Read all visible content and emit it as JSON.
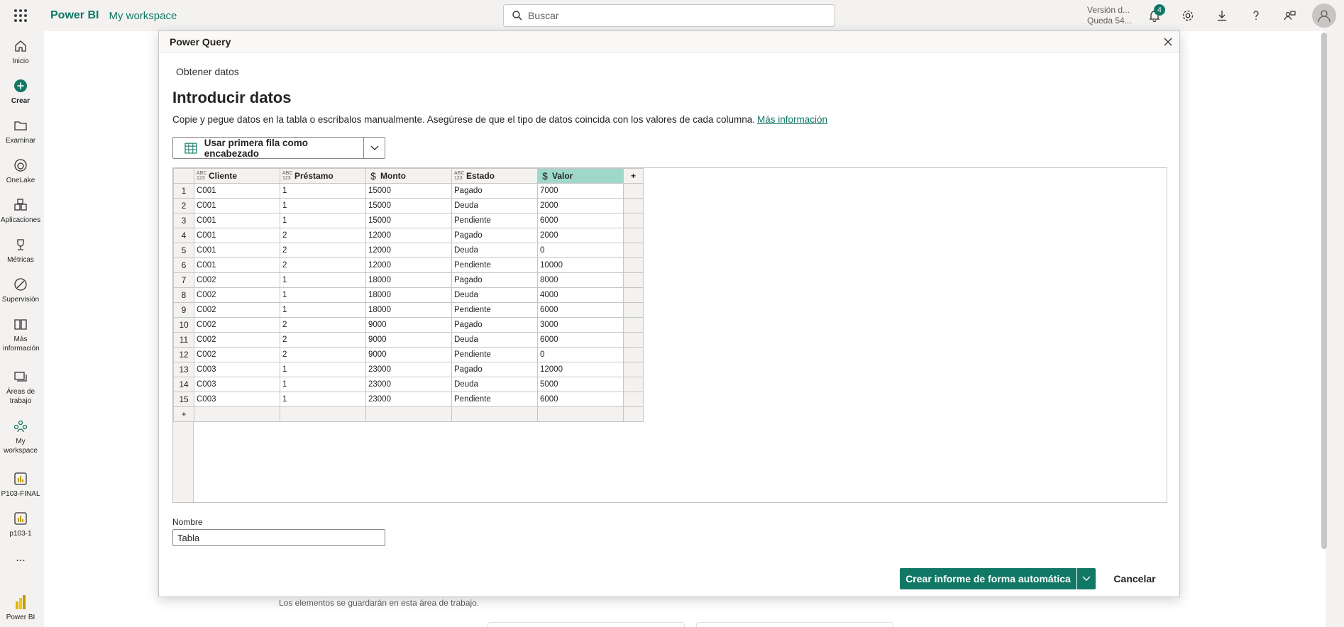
{
  "topbar": {
    "brand": "Power BI",
    "workspace": "My workspace",
    "search_placeholder": "Buscar",
    "trial_line1": "Versión d...",
    "trial_line2": "Queda 54...",
    "notification_count": "4",
    "icons": [
      "app-launcher-icon",
      "bell-icon",
      "gear-icon",
      "download-icon",
      "help-icon",
      "share-icon",
      "user-avatar-icon"
    ]
  },
  "leftnav": {
    "items": [
      {
        "label": "Inicio",
        "icon": "home-icon"
      },
      {
        "label": "Crear",
        "icon": "create-plus-icon"
      },
      {
        "label": "Examinar",
        "icon": "folder-icon"
      },
      {
        "label": "OneLake",
        "icon": "onelake-icon"
      },
      {
        "label": "Aplicaciones",
        "icon": "apps-icon"
      },
      {
        "label": "Métricas",
        "icon": "trophy-icon"
      },
      {
        "label": "Supervisión",
        "icon": "monitor-icon"
      },
      {
        "label": "Más información",
        "icon": "book-icon"
      },
      {
        "label": "Áreas de trabajo",
        "icon": "workspaces-icon"
      },
      {
        "label": "My workspace",
        "icon": "people-icon"
      },
      {
        "label": "P103-FINAL",
        "icon": "report-icon"
      },
      {
        "label": "p103-1",
        "icon": "report-icon"
      },
      {
        "label": "...",
        "icon": "more-icon"
      },
      {
        "label": "Power BI",
        "icon": "powerbi-logo-icon"
      }
    ]
  },
  "background": {
    "note": "Los elementos se guardarán en esta área de trabajo."
  },
  "dialog": {
    "header": "Power Query",
    "breadcrumb": "Obtener datos",
    "title": "Introducir datos",
    "description": "Copie y pegue datos en la tabla o escríbalos manualmente. Asegúrese de que el tipo de datos coincida con los valores de cada columna.",
    "more_info": "Más información",
    "header_button": "Usar primera fila como encabezado",
    "name_label": "Nombre",
    "name_value": "Tabla",
    "primary_button": "Crear informe de forma automática",
    "cancel_button": "Cancelar"
  },
  "table": {
    "columns": [
      {
        "name": "Cliente",
        "type": "ABC123"
      },
      {
        "name": "Préstamo",
        "type": "ABC123"
      },
      {
        "name": "Monto",
        "type": "currency"
      },
      {
        "name": "Estado",
        "type": "ABC123"
      },
      {
        "name": "Valor",
        "type": "currency",
        "selected": true
      }
    ],
    "add_column": "+",
    "add_row": "+",
    "type_label_top": "ABC",
    "type_label_bottom": "123",
    "currency_symbol": "$",
    "rows": [
      [
        "1",
        "C001",
        "1",
        "15000",
        "Pagado",
        "7000"
      ],
      [
        "2",
        "C001",
        "1",
        "15000",
        "Deuda",
        "2000"
      ],
      [
        "3",
        "C001",
        "1",
        "15000",
        "Pendiente",
        "6000"
      ],
      [
        "4",
        "C001",
        "2",
        "12000",
        "Pagado",
        "2000"
      ],
      [
        "5",
        "C001",
        "2",
        "12000",
        "Deuda",
        "0"
      ],
      [
        "6",
        "C001",
        "2",
        "12000",
        "Pendiente",
        "10000"
      ],
      [
        "7",
        "C002",
        "1",
        "18000",
        "Pagado",
        "8000"
      ],
      [
        "8",
        "C002",
        "1",
        "18000",
        "Deuda",
        "4000"
      ],
      [
        "9",
        "C002",
        "1",
        "18000",
        "Pendiente",
        "6000"
      ],
      [
        "10",
        "C002",
        "2",
        "9000",
        "Pagado",
        "3000"
      ],
      [
        "11",
        "C002",
        "2",
        "9000",
        "Deuda",
        "6000"
      ],
      [
        "12",
        "C002",
        "2",
        "9000",
        "Pendiente",
        "0"
      ],
      [
        "13",
        "C003",
        "1",
        "23000",
        "Pagado",
        "12000"
      ],
      [
        "14",
        "C003",
        "1",
        "23000",
        "Deuda",
        "5000"
      ],
      [
        "15",
        "C003",
        "1",
        "23000",
        "Pendiente",
        "6000"
      ]
    ]
  },
  "colors": {
    "accent": "#117865",
    "selected_header": "#9fd8cb"
  }
}
